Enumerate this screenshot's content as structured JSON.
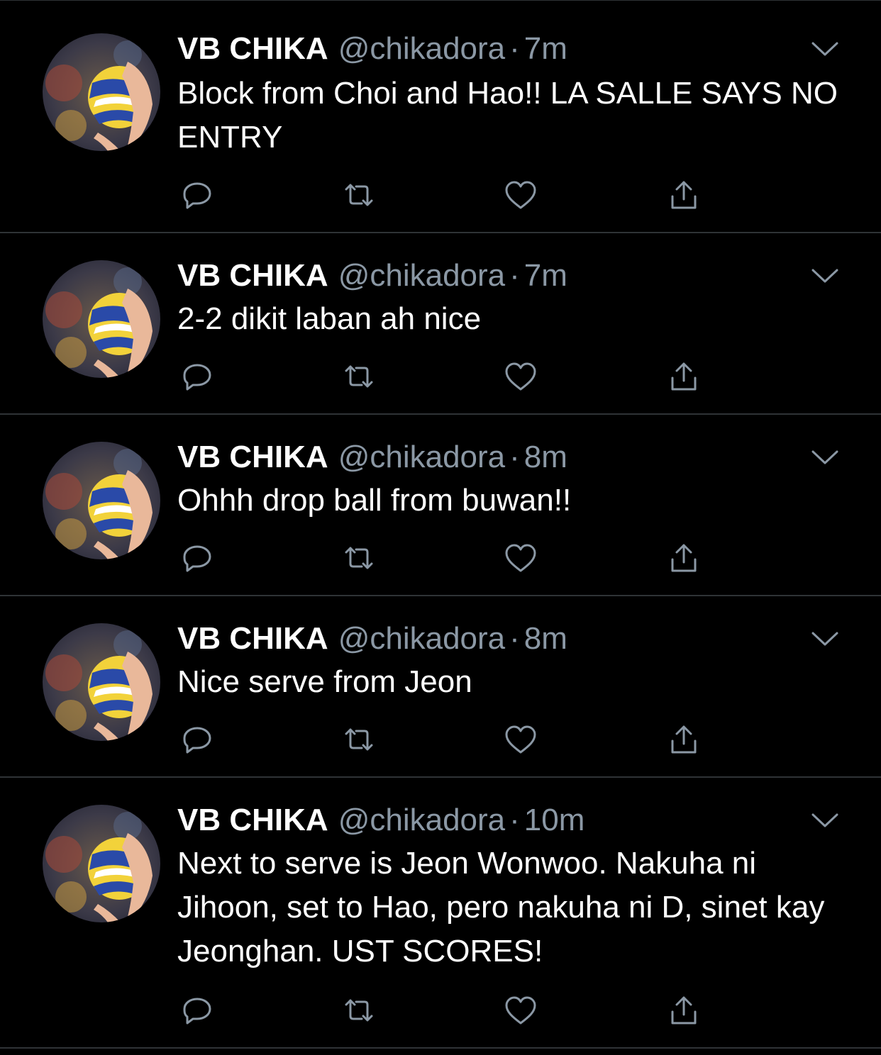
{
  "colors": {
    "background": "#000000",
    "divider": "#2f3336",
    "muted": "#8b98a5",
    "text": "#ffffff"
  },
  "tweets": [
    {
      "name": "VB CHIKA",
      "handle": "@chikadora",
      "separator": "·",
      "time": "7m",
      "text": "Block from Choi and Hao!! LA SALLE SAYS NO ENTRY"
    },
    {
      "name": "VB CHIKA",
      "handle": "@chikadora",
      "separator": "·",
      "time": "7m",
      "text": "2-2 dikit laban ah nice"
    },
    {
      "name": "VB CHIKA",
      "handle": "@chikadora",
      "separator": "·",
      "time": "8m",
      "text": "Ohhh drop ball from buwan!!"
    },
    {
      "name": "VB CHIKA",
      "handle": "@chikadora",
      "separator": "·",
      "time": "8m",
      "text": "Nice serve from Jeon"
    },
    {
      "name": "VB CHIKA",
      "handle": "@chikadora",
      "separator": "·",
      "time": "10m",
      "text": "Next to serve is Jeon Wonwoo. Nakuha ni Jihoon, set to Hao, pero nakuha ni D, sinet kay Jeonghan. UST SCORES!"
    }
  ],
  "icons": {
    "avatar": "volleyball-avatar",
    "menu": "chevron-down-icon",
    "reply": "reply-icon",
    "retweet": "retweet-icon",
    "like": "heart-icon",
    "share": "share-icon"
  }
}
